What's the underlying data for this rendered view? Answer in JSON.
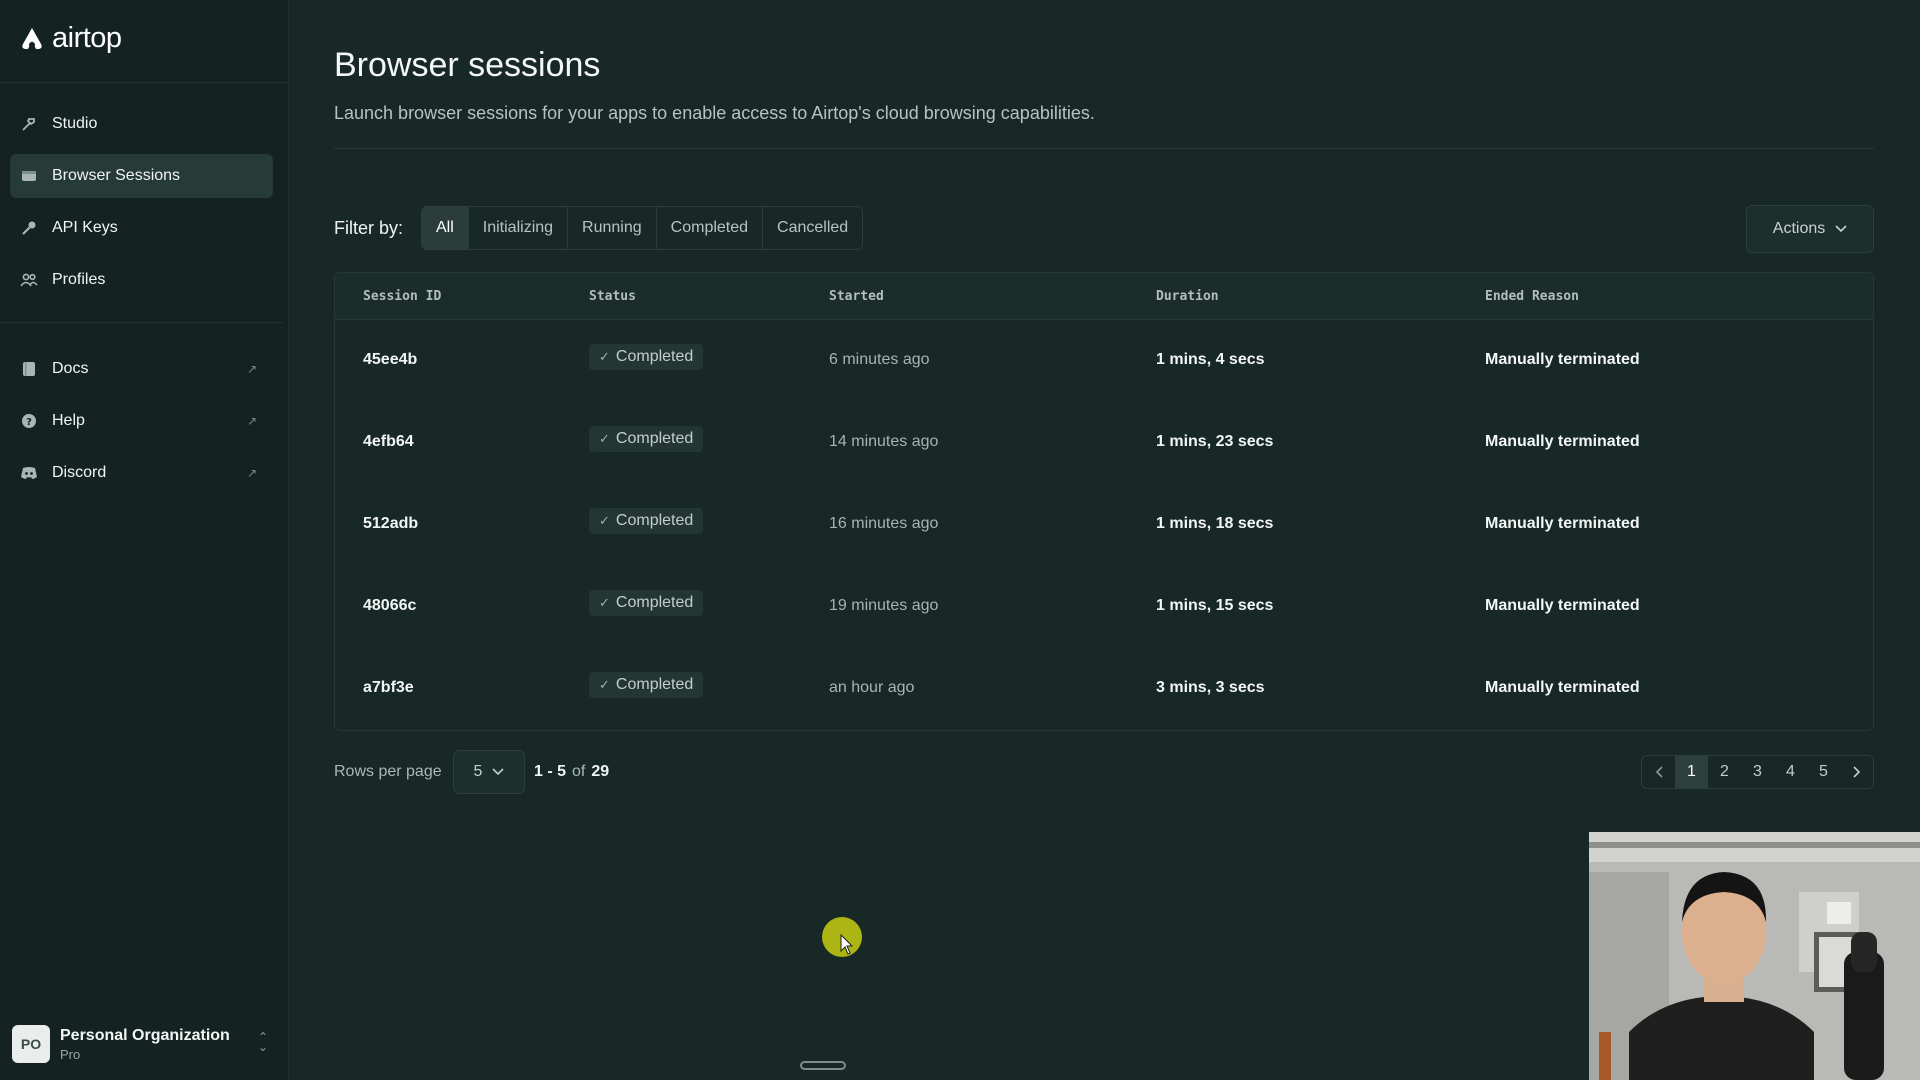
{
  "app": {
    "logo_text": "airtop"
  },
  "sidebar": {
    "items": [
      {
        "label": "Studio",
        "icon": "hammer-icon",
        "active": false
      },
      {
        "label": "Browser Sessions",
        "icon": "browser-icon",
        "active": true
      },
      {
        "label": "API Keys",
        "icon": "key-icon",
        "active": false
      },
      {
        "label": "Profiles",
        "icon": "users-icon",
        "active": false
      }
    ],
    "external_items": [
      {
        "label": "Docs",
        "icon": "book-icon",
        "ext_icon": "external-link-icon"
      },
      {
        "label": "Help",
        "icon": "help-circle-icon",
        "ext_icon": "external-link-icon"
      },
      {
        "label": "Discord",
        "icon": "discord-icon",
        "ext_icon": "external-link-icon"
      }
    ],
    "org": {
      "avatar": "PO",
      "name": "Personal Organization",
      "plan": "Pro"
    }
  },
  "page": {
    "title": "Browser sessions",
    "subtitle": "Launch browser sessions for your apps to enable access to Airtop's cloud browsing capabilities."
  },
  "filter": {
    "label": "Filter by:",
    "options": [
      "All",
      "Initializing",
      "Running",
      "Completed",
      "Cancelled"
    ],
    "selected": "All",
    "actions_label": "Actions"
  },
  "table": {
    "columns": [
      "Session ID",
      "Status",
      "Started",
      "Duration",
      "Ended Reason"
    ],
    "rows": [
      {
        "id": "45ee4b",
        "status": "Completed",
        "started": "6 minutes ago",
        "duration": "1 mins, 4 secs",
        "reason": "Manually terminated"
      },
      {
        "id": "4efb64",
        "status": "Completed",
        "started": "14 minutes ago",
        "duration": "1 mins, 23 secs",
        "reason": "Manually terminated"
      },
      {
        "id": "512adb",
        "status": "Completed",
        "started": "16 minutes ago",
        "duration": "1 mins, 18 secs",
        "reason": "Manually terminated"
      },
      {
        "id": "48066c",
        "status": "Completed",
        "started": "19 minutes ago",
        "duration": "1 mins, 15 secs",
        "reason": "Manually terminated"
      },
      {
        "id": "a7bf3e",
        "status": "Completed",
        "started": "an hour ago",
        "duration": "3 mins, 3 secs",
        "reason": "Manually terminated"
      }
    ]
  },
  "pagination": {
    "rows_per_page_label": "Rows per page",
    "rows_per_page": "5",
    "range": "1 - 5",
    "of_label": "of",
    "total": "29",
    "pages": [
      "1",
      "2",
      "3",
      "4",
      "5"
    ],
    "current_page": "1"
  },
  "colors": {
    "background": "#172826",
    "sidebar": "#142321",
    "cursor_highlight": "#b4bd12"
  }
}
